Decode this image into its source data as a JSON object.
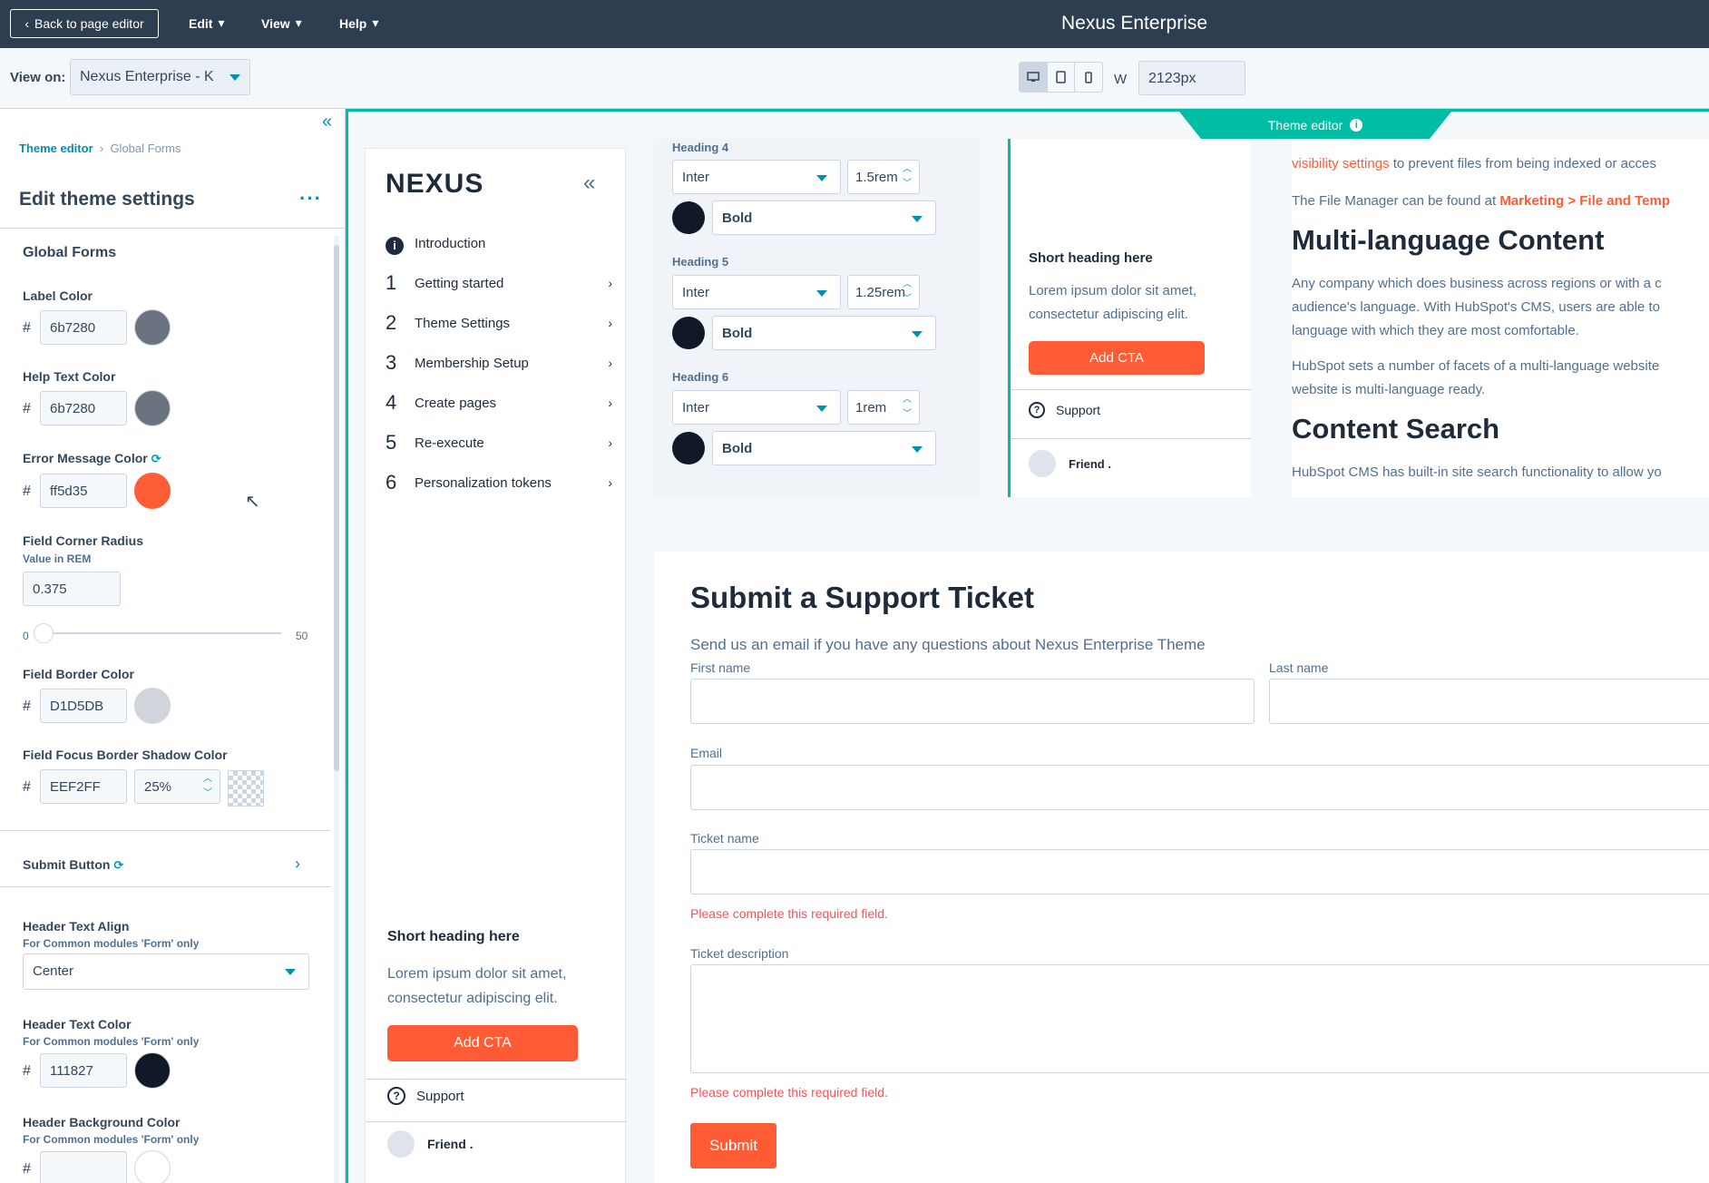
{
  "topbar": {
    "back_label": "Back to page editor",
    "menus": [
      "Edit",
      "View",
      "Help"
    ],
    "app_title": "Nexus Enterprise"
  },
  "subbar": {
    "view_on_label": "View on:",
    "view_on_value": "Nexus Enterprise - K",
    "width_label": "W",
    "width_value": "2123px"
  },
  "leftpanel": {
    "breadcrumb": {
      "root": "Theme editor",
      "current": "Global Forms"
    },
    "title": "Edit theme settings",
    "section": "Global Forms",
    "label_color": {
      "label": "Label Color",
      "hex": "6b7280",
      "swatch": "#6b7280"
    },
    "help_text_color": {
      "label": "Help Text Color",
      "hex": "6b7280",
      "swatch": "#6b7280"
    },
    "error_message_color": {
      "label": "Error Message Color",
      "hex": "ff5d35",
      "swatch": "#ff5d35"
    },
    "field_corner_radius": {
      "label": "Field Corner Radius",
      "sub": "Value in REM",
      "value": "0.375",
      "min": "0",
      "max": "50"
    },
    "field_border_color": {
      "label": "Field Border Color",
      "hex": "D1D5DB",
      "swatch": "#D1D5DB"
    },
    "field_focus_shadow": {
      "label": "Field Focus Border Shadow Color",
      "hex": "EEF2FF",
      "opacity": "25%"
    },
    "submit_button": "Submit Button",
    "header_text_align": {
      "label": "Header Text Align",
      "sub": "For Common modules 'Form' only",
      "value": "Center"
    },
    "header_text_color": {
      "label": "Header Text Color",
      "sub": "For Common modules 'Form' only",
      "hex": "111827",
      "swatch": "#111827"
    },
    "header_bg_color": {
      "label": "Header Background Color",
      "sub": "For Common modules 'Form' only",
      "hex": "",
      "swatch": "#ffffff"
    }
  },
  "preview": {
    "theme_tab": "Theme editor",
    "nav": {
      "logo": "NEXUS",
      "items": [
        {
          "num": "",
          "label": "Introduction"
        },
        {
          "num": "1",
          "label": "Getting started"
        },
        {
          "num": "2",
          "label": "Theme Settings"
        },
        {
          "num": "3",
          "label": "Membership Setup"
        },
        {
          "num": "4",
          "label": "Create pages"
        },
        {
          "num": "5",
          "label": "Re-execute"
        },
        {
          "num": "6",
          "label": "Personalization tokens"
        }
      ],
      "short_heading": "Short heading here",
      "short_text": "Lorem ipsum dolor sit amet, consectetur adipiscing elit.",
      "cta": "Add CTA",
      "support": "Support",
      "friend": "Friend ."
    },
    "headings": [
      {
        "label": "Heading 4",
        "font": "Inter",
        "size": "1.5rem",
        "weight": "Bold"
      },
      {
        "label": "Heading 5",
        "font": "Inter",
        "size": "1.25rem",
        "weight": "Bold"
      },
      {
        "label": "Heading 6",
        "font": "Inter",
        "size": "1rem",
        "weight": "Bold"
      }
    ],
    "mid": {
      "short_heading": "Short heading here",
      "short_text": "Lorem ipsum dolor sit amet, consectetur adipiscing elit.",
      "cta": "Add CTA",
      "support": "Support",
      "friend": "Friend ."
    },
    "article": {
      "p1_link": "visibility settings",
      "p1_rest": " to prevent files from being indexed or acces",
      "p2_text": "The File Manager can be found at ",
      "p2_link": "Marketing > File and Temp",
      "h1": "Multi-language Content",
      "p3a": "Any company which does business across regions or with a c",
      "p3b": "audience's language. With HubSpot's CMS, users are able to",
      "p3c": "language with which they are most comfortable.",
      "p4a": "HubSpot sets a number of facets of a multi-language website",
      "p4b": "website is multi-language ready.",
      "h2": "Content Search",
      "p5": "HubSpot CMS has built-in site search functionality to allow yo"
    },
    "form": {
      "title": "Submit a Support Ticket",
      "description": "Send us an email if you have any questions about Nexus Enterprise Theme",
      "first_name": "First name",
      "last_name": "Last name",
      "email": "Email",
      "ticket_name": "Ticket name",
      "ticket_description": "Ticket description",
      "error": "Please complete this required field.",
      "submit": "Submit"
    }
  }
}
